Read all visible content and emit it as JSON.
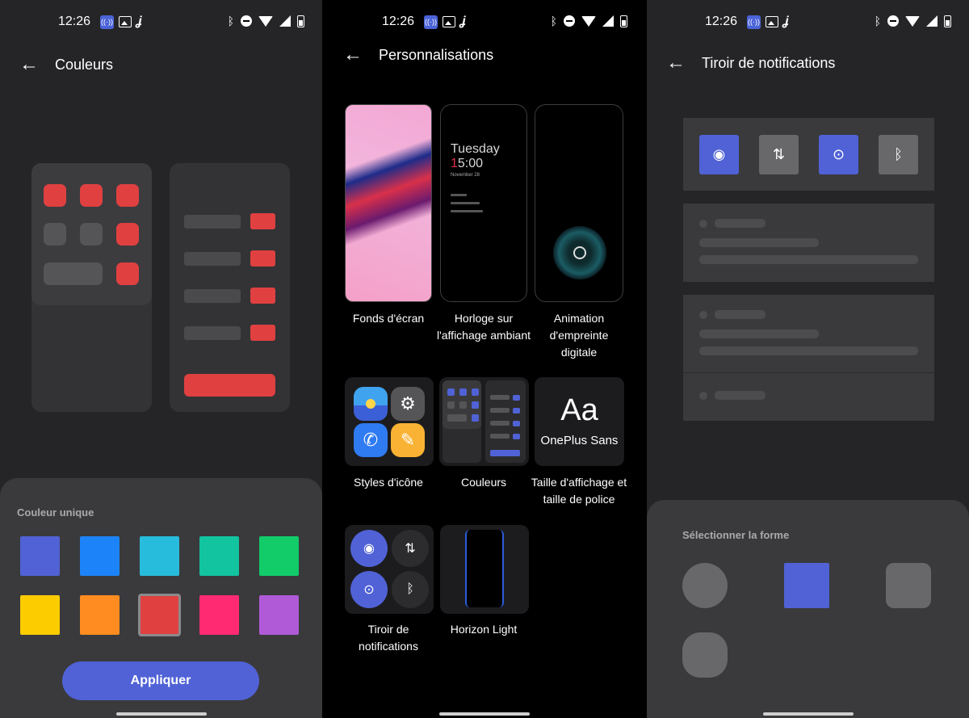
{
  "status_bar": {
    "time": "12:26",
    "left_icons": [
      "hotspot-icon",
      "gallery-icon",
      "j-icon"
    ],
    "right_icons": [
      "bluetooth-icon",
      "dnd-icon",
      "wifi-icon",
      "signal-icon",
      "battery-icon"
    ]
  },
  "panel1": {
    "title": "Couleurs",
    "sheet_label": "Couleur unique",
    "swatches": [
      "#5062d6",
      "#1c84f8",
      "#28bcdc",
      "#12c4a0",
      "#12cc6a",
      "#fdcc00",
      "#ff8c20",
      "#e04040",
      "#ff2a72",
      "#b05ad8"
    ],
    "selected_swatch": "#e04040",
    "apply_label": "Appliquer",
    "accent_color": "#e04040"
  },
  "panel2": {
    "title": "Personnalisations",
    "tiles": [
      {
        "caption": "Fonds d'écran"
      },
      {
        "caption": "Horloge sur l'affichage ambiant"
      },
      {
        "caption": "Animation d'empreinte digitale"
      },
      {
        "caption": "Styles d'icône"
      },
      {
        "caption": "Couleurs"
      },
      {
        "caption": "Taille d'affichage et taille de police"
      },
      {
        "caption": "Tiroir de notifications"
      },
      {
        "caption": "Horizon Light"
      }
    ],
    "aod": {
      "day": "Tuesday",
      "hour_accent": "1",
      "hour_rest": "5:00",
      "date": "November 28"
    },
    "font_preview": {
      "sample": "Aa",
      "font_name": "OnePlus Sans"
    }
  },
  "panel3": {
    "title": "Tiroir de notifications",
    "sheet_label": "Sélectionner la forme",
    "quick_settings": [
      {
        "icon": "wifi-icon",
        "active": true
      },
      {
        "icon": "data-icon",
        "active": false
      },
      {
        "icon": "location-icon",
        "active": true
      },
      {
        "icon": "bluetooth-icon",
        "active": false
      }
    ],
    "shapes": [
      "circle",
      "square",
      "rounded-square",
      "squircle"
    ],
    "selected_shape": "square",
    "accent_color": "#5062d6"
  }
}
